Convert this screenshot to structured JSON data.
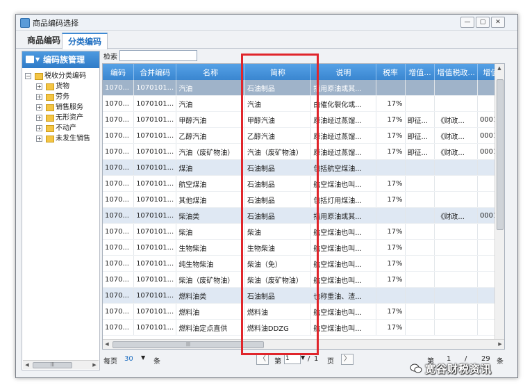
{
  "window": {
    "title": "商品编码选择"
  },
  "tabs": [
    {
      "label": "商品编码"
    },
    {
      "label": "分类编码"
    }
  ],
  "left_panel": {
    "header": "编码族管理",
    "tree": {
      "root": "税收分类编码",
      "children": [
        "货物",
        "劳务",
        "销售服务",
        "无形资产",
        "不动产",
        "未发生销售"
      ]
    }
  },
  "search": {
    "label": "检索",
    "value": ""
  },
  "grid": {
    "columns": [
      "编码",
      "合并编码",
      "名称",
      "简称",
      "说明",
      "税率",
      "增值...",
      "增值税政...",
      "增值"
    ],
    "rows": [
      {
        "kind": "sel",
        "cells": [
          "1070...",
          "1070101...",
          "汽油",
          "石油制品",
          "指用原油或其...",
          "",
          "",
          "",
          ""
        ]
      },
      {
        "kind": "normal",
        "cells": [
          "1070...",
          "1070101...",
          "汽油",
          "汽油",
          "由催化裂化或...",
          "17%",
          "",
          "",
          ""
        ]
      },
      {
        "kind": "normal",
        "cells": [
          "1070...",
          "1070101...",
          "甲醇汽油",
          "甲醇汽油",
          "原油经过蒸馏...",
          "17%",
          "即征...",
          "《财政...",
          "0001"
        ]
      },
      {
        "kind": "normal",
        "cells": [
          "1070...",
          "1070101...",
          "乙醇汽油",
          "乙醇汽油",
          "原油经过蒸馏...",
          "17%",
          "即征...",
          "《财政...",
          "0001"
        ]
      },
      {
        "kind": "normal",
        "cells": [
          "1070...",
          "1070101...",
          "汽油（废矿物油）",
          "汽油（废矿物油）",
          "原油经过蒸馏...",
          "17%",
          "即征...",
          "《财政...",
          "0001"
        ]
      },
      {
        "kind": "parent",
        "cells": [
          "1070...",
          "1070101...",
          "煤油",
          "石油制品",
          "包括航空煤油...",
          "",
          "",
          "",
          ""
        ]
      },
      {
        "kind": "normal",
        "cells": [
          "1070...",
          "1070101...",
          "航空煤油",
          "石油制品",
          "航空煤油也叫...",
          "17%",
          "",
          "",
          ""
        ]
      },
      {
        "kind": "normal",
        "cells": [
          "1070...",
          "1070101...",
          "其他煤油",
          "石油制品",
          "包括灯用煤油...",
          "17%",
          "",
          "",
          ""
        ]
      },
      {
        "kind": "parent",
        "cells": [
          "1070...",
          "1070101...",
          "柴油类",
          "石油制品",
          "指用原油或其...",
          "",
          "",
          "《财政...",
          "0001"
        ]
      },
      {
        "kind": "normal",
        "cells": [
          "1070...",
          "1070101...",
          "柴油",
          "柴油",
          "航空煤油也叫...",
          "17%",
          "",
          "",
          ""
        ]
      },
      {
        "kind": "normal",
        "cells": [
          "1070...",
          "1070101...",
          "生物柴油",
          "生物柴油",
          "航空煤油也叫...",
          "17%",
          "",
          "",
          ""
        ]
      },
      {
        "kind": "normal",
        "cells": [
          "1070...",
          "1070101...",
          "纯生物柴油",
          "柴油（免）",
          "航空煤油也叫...",
          "17%",
          "",
          "",
          ""
        ]
      },
      {
        "kind": "normal",
        "cells": [
          "1070...",
          "1070101...",
          "柴油（废矿物油）",
          "柴油（废矿物油）",
          "航空煤油也叫...",
          "17%",
          "",
          "",
          ""
        ]
      },
      {
        "kind": "parent",
        "cells": [
          "1070...",
          "1070101...",
          "燃料油类",
          "石油制品",
          "也称重油、渣...",
          "",
          "",
          "",
          ""
        ]
      },
      {
        "kind": "normal",
        "cells": [
          "1070...",
          "1070101...",
          "燃料油",
          "燃料油",
          "航空煤油也叫...",
          "17%",
          "",
          "",
          ""
        ]
      },
      {
        "kind": "normal",
        "cells": [
          "1070...",
          "1070101...",
          "燃料油定点直供",
          "燃料油DDZG",
          "航空煤油也叫...",
          "17%",
          "",
          "",
          ""
        ]
      }
    ]
  },
  "pager": {
    "per_page_label": "每页",
    "per_page_value": "30",
    "unit": "条",
    "page_prefix": "第",
    "current_page": "1",
    "separator": "/",
    "total_pages": "1",
    "page_suffix": "页",
    "right_prefix": "第",
    "right_from": "1",
    "right_sep": "/",
    "right_to": "29",
    "right_unit": "条"
  },
  "watermark": "宽谷财税资讯",
  "colors": {
    "header_blue": "#3a86d0",
    "highlight_red": "#e0252b",
    "tab_active": "#1f6fc1"
  }
}
